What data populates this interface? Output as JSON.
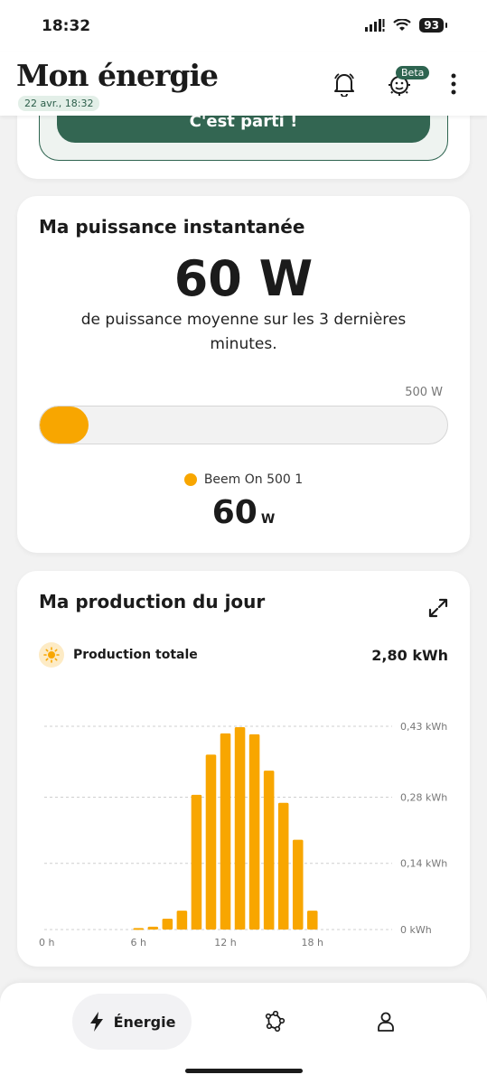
{
  "status_bar": {
    "time": "18:32",
    "battery": "93"
  },
  "header": {
    "title": "Mon énergie",
    "date": "22 avr., 18:32",
    "beta_label": "Beta"
  },
  "promo": {
    "button_label": "C'est parti !"
  },
  "power": {
    "title": "Ma puissance instantanée",
    "value": "60 W",
    "description": "de puissance moyenne sur les 3 dernières minutes.",
    "max_label": "500 W",
    "fill_fraction": 0.12,
    "device_name": "Beem On 500 1",
    "device_value": "60",
    "device_unit": "W"
  },
  "production": {
    "title": "Ma production du jour",
    "total_label": "Production totale",
    "total_value": "2,80 kWh"
  },
  "chart_data": {
    "type": "bar",
    "x": [
      6,
      7,
      8,
      9,
      10,
      11,
      12,
      13,
      14,
      15,
      16,
      17
    ],
    "values": [
      0.003,
      0.006,
      0.023,
      0.04,
      0.285,
      0.37,
      0.415,
      0.428,
      0.413,
      0.336,
      0.268,
      0.19,
      0.04
    ],
    "categories": [
      "6 h",
      "7 h",
      "8 h",
      "9 h",
      "10 h",
      "11 h",
      "12 h",
      "13 h",
      "14 h",
      "15 h",
      "16 h",
      "17 h",
      "18 h"
    ],
    "x_ticks": [
      "0 h",
      "6 h",
      "12 h",
      "18 h"
    ],
    "y_ticks": [
      "0 kWh",
      "0,14 kWh",
      "0,28 kWh",
      "0,43 kWh"
    ],
    "y_tick_values": [
      0,
      0.14,
      0.28,
      0.43
    ],
    "ylim": [
      0,
      0.43
    ],
    "xlim": [
      0,
      24
    ],
    "grid": true,
    "color": "#f8a600"
  },
  "nav": {
    "energy_label": "Énergie"
  },
  "colors": {
    "accent": "#f8a600",
    "brand_green": "#336652"
  }
}
